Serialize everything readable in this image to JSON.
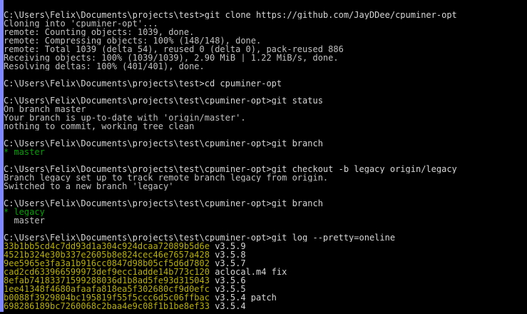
{
  "terminal": {
    "lines": [
      {
        "type": "prompt",
        "text": "C:\\Users\\Felix\\Documents\\projects\\test>git clone https://github.com/JayDDee/cpuminer-opt"
      },
      {
        "type": "out",
        "text": "Cloning into 'cpuminer-opt'..."
      },
      {
        "type": "out",
        "text": "remote: Counting objects: 1039, done."
      },
      {
        "type": "out",
        "text": "remote: Compressing objects: 100% (148/148), done."
      },
      {
        "type": "out",
        "text": "remote: Total 1039 (delta 54), reused 0 (delta 0), pack-reused 886"
      },
      {
        "type": "out",
        "text": "Receiving objects: 100% (1039/1039), 2.90 MiB | 1.22 MiB/s, done."
      },
      {
        "type": "out",
        "text": "Resolving deltas: 100% (401/401), done."
      },
      {
        "type": "gap",
        "text": ""
      },
      {
        "type": "prompt",
        "text": "C:\\Users\\Felix\\Documents\\projects\\test>cd cpuminer-opt"
      },
      {
        "type": "gap",
        "text": ""
      },
      {
        "type": "prompt",
        "text": "C:\\Users\\Felix\\Documents\\projects\\test\\cpuminer-opt>git status"
      },
      {
        "type": "out",
        "text": "On branch master"
      },
      {
        "type": "out",
        "text": "Your branch is up-to-date with 'origin/master'."
      },
      {
        "type": "out",
        "text": "nothing to commit, working tree clean"
      },
      {
        "type": "gap",
        "text": ""
      },
      {
        "type": "prompt",
        "text": "C:\\Users\\Felix\\Documents\\projects\\test\\cpuminer-opt>git branch"
      },
      {
        "type": "branch-current",
        "text": "* master"
      },
      {
        "type": "gap",
        "text": ""
      },
      {
        "type": "prompt",
        "text": "C:\\Users\\Felix\\Documents\\projects\\test\\cpuminer-opt>git checkout -b legacy origin/legacy"
      },
      {
        "type": "out",
        "text": "Branch legacy set up to track remote branch legacy from origin."
      },
      {
        "type": "out",
        "text": "Switched to a new branch 'legacy'"
      },
      {
        "type": "gap",
        "text": ""
      },
      {
        "type": "prompt",
        "text": "C:\\Users\\Felix\\Documents\\projects\\test\\cpuminer-opt>git branch"
      },
      {
        "type": "branch-current",
        "text": "* legacy"
      },
      {
        "type": "out",
        "text": "  master"
      },
      {
        "type": "gap",
        "text": ""
      },
      {
        "type": "prompt",
        "text": "C:\\Users\\Felix\\Documents\\projects\\test\\cpuminer-opt>git log --pretty=oneline"
      },
      {
        "type": "commit",
        "hash": "33b1bb5cd4c7dd93d1a304c924dcaa72089b5d6e",
        "message": " v3.5.9"
      },
      {
        "type": "commit",
        "hash": "4521b324e30b337e2605b8e824cec46e7657a428",
        "message": " v3.5.8"
      },
      {
        "type": "commit",
        "hash": "9ee5965e3fa3a1b916cc0847d98b05cf5d6d7802",
        "message": " v3.5.7"
      },
      {
        "type": "commit",
        "hash": "cad2cd633966599973def9ecc1adde14b773c120",
        "message": " aclocal.m4 fix"
      },
      {
        "type": "commit",
        "hash": "8efab74183371599288036d1b8ad5fe93d315043",
        "message": " v3.5.6"
      },
      {
        "type": "commit",
        "hash": "1ee41348f4680afaafa818ea5f302680cf9d0efc",
        "message": " v3.5.5"
      },
      {
        "type": "commit",
        "hash": "b0088f3929804bc195819f55f5ccc6d5c06ffbac",
        "message": " v3.5.4 patch"
      },
      {
        "type": "commit",
        "hash": "698286189bc7260068c2baa4e9c08f1b1be8ef33",
        "message": " v3.5.4"
      }
    ]
  },
  "colors": {
    "background": "#000000",
    "text": "#c0c0c0",
    "branch_current": "#00a000",
    "commit_hash": "#b8b000",
    "left_edge": "#7f88ff"
  }
}
